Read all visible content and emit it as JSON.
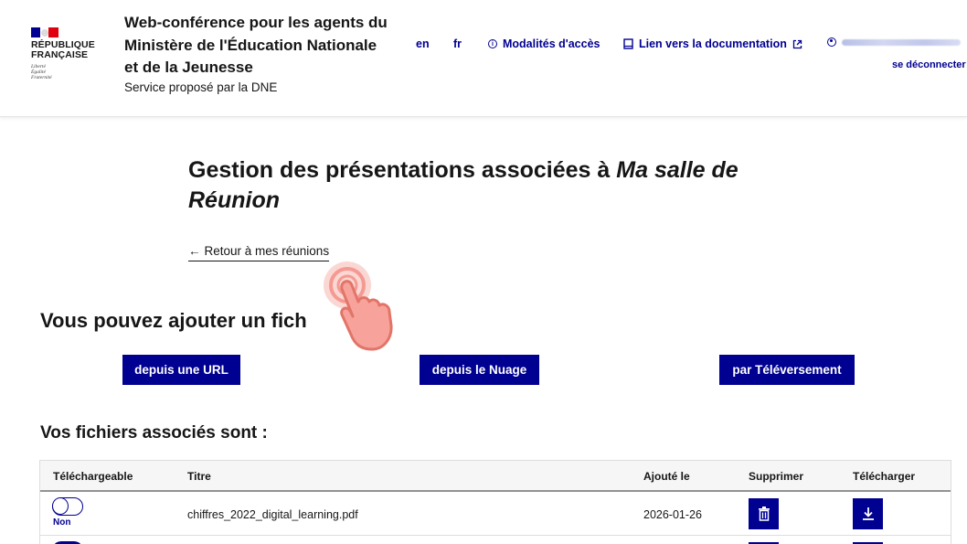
{
  "header": {
    "republic": [
      "RÉPUBLIQUE",
      "FRANÇAISE"
    ],
    "motto": [
      "Liberté",
      "Égalité",
      "Fraternité"
    ],
    "service_title": "Web-conférence pour les agents du Ministère de l'Éducation Nationale et de la Jeunesse",
    "service_subtitle": "Service proposé par la DNE",
    "tools": {
      "lang_en": "en",
      "lang_fr": "fr",
      "access": "Modalités d'accès",
      "docs": "Lien vers la documentation",
      "logout": "se déconnecter"
    }
  },
  "main": {
    "title_prefix": "Gestion des présentations associées à",
    "title_room": "Ma salle de Réunion",
    "back_link": "Retour à mes réunions",
    "add_title": "Vous pouvez ajouter un fich",
    "buttons": {
      "url": "depuis une URL",
      "cloud": "depuis le Nuage",
      "upload": "par Téléversement"
    },
    "files_title": "Vos fichiers associés sont :",
    "table": {
      "headers": [
        "Téléchargeable",
        "Titre",
        "Ajouté le",
        "Supprimer",
        "Télécharger"
      ],
      "rows": [
        {
          "downloadable": "Non",
          "title": "chiffres_2022_digital_learning.pdf",
          "added": "2026-01-26"
        }
      ]
    }
  },
  "colors": {
    "primary": "#000091",
    "flag_red": "#e1000f",
    "touch": "#f28b82"
  },
  "icons": [
    "info-icon",
    "book-icon",
    "external-link-icon",
    "user-icon",
    "arrow-left-icon",
    "trash-icon",
    "download-icon",
    "touch-hand-icon"
  ]
}
